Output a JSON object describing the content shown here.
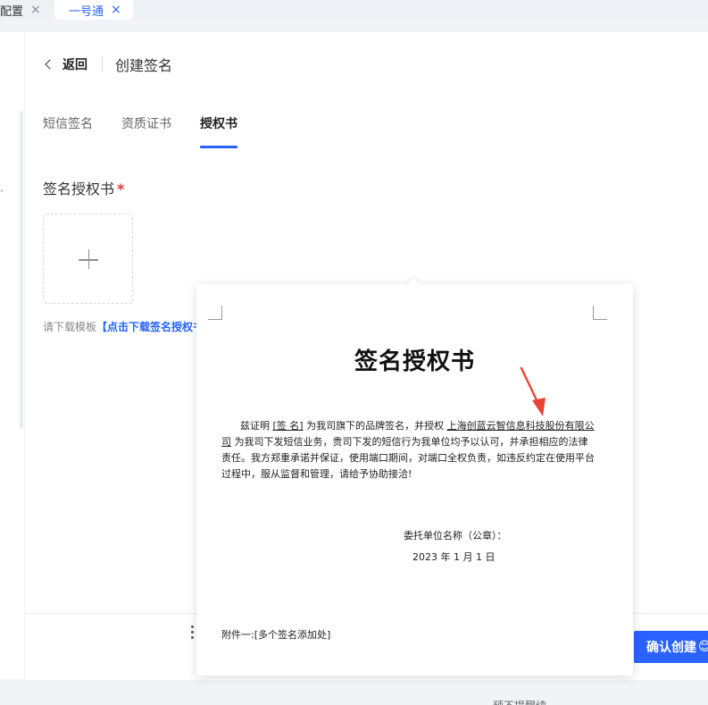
{
  "tabbar": {
    "tabs": [
      {
        "label": "配置",
        "close": "×"
      },
      {
        "label": "一号通",
        "close": "×"
      }
    ]
  },
  "sidebar": {
    "glyph": "’"
  },
  "header": {
    "back_label": "返回",
    "title": "创建签名"
  },
  "tabs": [
    {
      "label": "短信签名",
      "active": false
    },
    {
      "label": "资质证书",
      "active": false
    },
    {
      "label": "授权书",
      "active": true
    }
  ],
  "form": {
    "field_label": "签名授权书",
    "required_mark": "*",
    "upload_plus": "+",
    "hint_prefix": "请下载模板",
    "hint_link": "【点击下载签名授权书】"
  },
  "popover": {
    "doc_title": "签名授权书",
    "body": {
      "p1": "兹证明",
      "sign_placeholder": "[签 名]",
      "p2": "为我司旗下的品牌签名，并授权",
      "company": "上海创蓝云智信息科技股份有限公司",
      "p3": "为我司下发短信业务，贵司下发的短信行为我单位均予以认可，并承担相应的法律责任。我方郑重承诺并保证，使用端口期间，对端口全权负责，如违反约定在使用平台过程中，服从监督和管理，请给予协助接洽!"
    },
    "sign_line": "委托单位名称（公章）：",
    "date_line": "2023 年 1 月 1 日",
    "attachment": "附件一:[多个签名添加处]"
  },
  "footer": {
    "confirm_label": "确认创建",
    "confirm_emoji": "😊"
  },
  "bottom_cut_text": "预不提醒续"
}
